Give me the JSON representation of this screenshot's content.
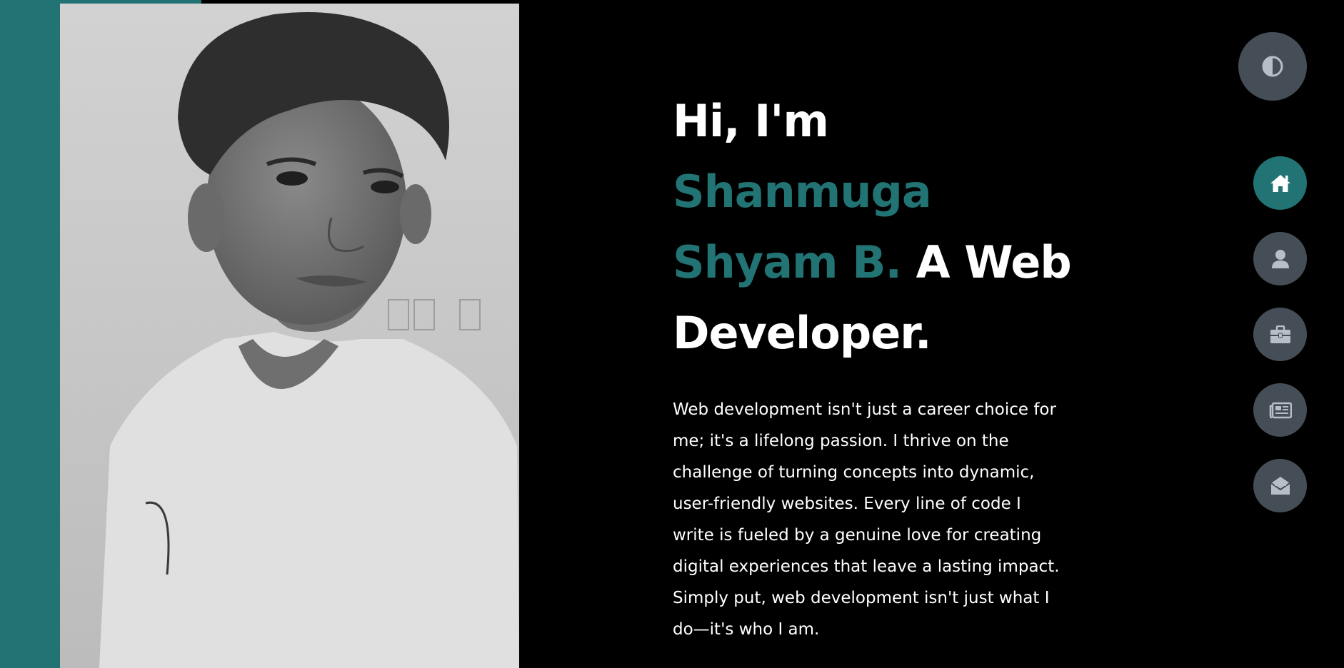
{
  "hero": {
    "greeting": "Hi, I'm",
    "name_line1": "Shanmuga",
    "name_line2": "Shyam B.",
    "role_line1": " A Web",
    "role_line2": "Developer.",
    "description": "Web development isn't just a career choice for me; it's a lifelong passion. I thrive on the challenge of turning concepts into dynamic, user-friendly websites. Every line of code I write is fueled by a genuine love for creating digital experiences that leave a lasting impact. Simply put, web development isn't just what I do—it's who I am."
  },
  "page_progress": 0.15,
  "theme_toggle": {
    "icon": "contrast-icon"
  },
  "nav": [
    {
      "icon": "home-icon",
      "active": true
    },
    {
      "icon": "user-icon",
      "active": false
    },
    {
      "icon": "briefcase-icon",
      "active": false
    },
    {
      "icon": "newspaper-icon",
      "active": false
    },
    {
      "icon": "envelope-open-icon",
      "active": false
    }
  ],
  "colors": {
    "accent": "#227373",
    "background": "#000000",
    "button": "#454e56",
    "text": "#ffffff",
    "icon": "#b7bec6"
  }
}
